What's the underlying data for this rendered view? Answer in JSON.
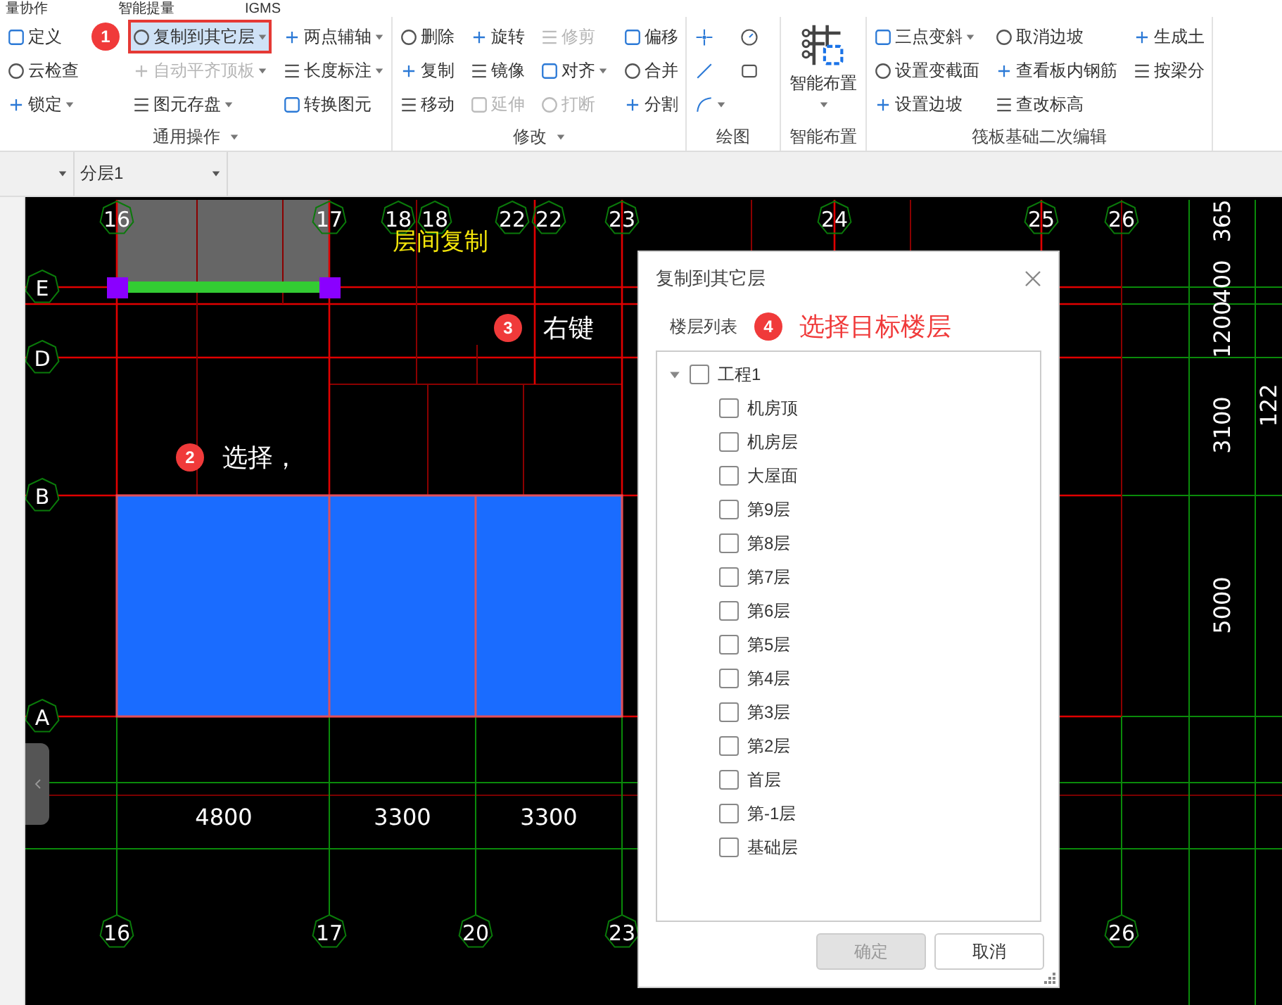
{
  "menu_tabs": [
    "量协作",
    "智能提量",
    "IGMS"
  ],
  "ribbon": {
    "groups": [
      {
        "kind": "columns",
        "title": "通用操作",
        "dropdown": true,
        "columns": [
          [
            {
              "label": "定义",
              "dropdown": false,
              "selected": false,
              "disabled": false
            },
            {
              "label": "云检查",
              "dropdown": false,
              "selected": false,
              "disabled": false
            },
            {
              "label": "锁定",
              "dropdown": true,
              "selected": false,
              "disabled": false
            }
          ],
          [
            {
              "label": "复制到其它层",
              "dropdown": true,
              "selected": true,
              "disabled": false
            },
            {
              "label": "自动平齐顶板",
              "dropdown": true,
              "selected": false,
              "disabled": true
            },
            {
              "label": "图元存盘",
              "dropdown": true,
              "selected": false,
              "disabled": false
            }
          ],
          [
            {
              "label": "两点辅轴",
              "dropdown": true,
              "selected": false,
              "disabled": false
            },
            {
              "label": "长度标注",
              "dropdown": true,
              "selected": false,
              "disabled": false
            },
            {
              "label": "转换图元",
              "dropdown": false,
              "selected": false,
              "disabled": false
            }
          ]
        ]
      },
      {
        "kind": "columns",
        "title": "修改",
        "dropdown": true,
        "columns": [
          [
            {
              "label": "删除",
              "dropdown": false,
              "selected": false,
              "disabled": false
            },
            {
              "label": "复制",
              "dropdown": false,
              "selected": false,
              "disabled": false
            },
            {
              "label": "移动",
              "dropdown": false,
              "selected": false,
              "disabled": false
            }
          ],
          [
            {
              "label": "旋转",
              "dropdown": false,
              "selected": false,
              "disabled": false
            },
            {
              "label": "镜像",
              "dropdown": false,
              "selected": false,
              "disabled": false
            },
            {
              "label": "延伸",
              "dropdown": false,
              "selected": false,
              "disabled": true
            }
          ],
          [
            {
              "label": "修剪",
              "dropdown": false,
              "selected": false,
              "disabled": true
            },
            {
              "label": "对齐",
              "dropdown": true,
              "selected": false,
              "disabled": false
            },
            {
              "label": "打断",
              "dropdown": false,
              "selected": false,
              "disabled": true
            }
          ],
          [
            {
              "label": "偏移",
              "dropdown": false,
              "selected": false,
              "disabled": false
            },
            {
              "label": "合并",
              "dropdown": false,
              "selected": false,
              "disabled": false
            },
            {
              "label": "分割",
              "dropdown": false,
              "selected": false,
              "disabled": false
            }
          ]
        ]
      },
      {
        "kind": "icons",
        "title": "绘图",
        "dropdown": false,
        "tools": [
          {
            "kind": "point",
            "dropdown": false
          },
          {
            "kind": "circle",
            "dropdown": false
          },
          {
            "kind": "line",
            "dropdown": false
          },
          {
            "kind": "rect",
            "dropdown": false
          },
          {
            "kind": "arc",
            "dropdown": true
          }
        ]
      },
      {
        "kind": "big",
        "title": "智能布置",
        "dropdown": false,
        "tool": {
          "label": "智能布置",
          "dropdown": true
        }
      },
      {
        "kind": "columns",
        "title": "筏板基础二次编辑",
        "dropdown": false,
        "columns": [
          [
            {
              "label": "三点变斜",
              "dropdown": true,
              "selected": false,
              "disabled": false
            },
            {
              "label": "设置变截面",
              "dropdown": false,
              "selected": false,
              "disabled": false
            },
            {
              "label": "设置边坡",
              "dropdown": false,
              "selected": false,
              "disabled": false
            }
          ],
          [
            {
              "label": "取消边坡",
              "dropdown": false,
              "selected": false,
              "disabled": false
            },
            {
              "label": "查看板内钢筋",
              "dropdown": false,
              "selected": false,
              "disabled": false
            },
            {
              "label": "查改标高",
              "dropdown": false,
              "selected": false,
              "disabled": false
            }
          ],
          [
            {
              "label": "生成土",
              "dropdown": false,
              "selected": false,
              "disabled": false
            },
            {
              "label": "按梁分",
              "dropdown": false,
              "selected": false,
              "disabled": false
            }
          ]
        ]
      }
    ]
  },
  "layer_bar": {
    "layer": "分层1"
  },
  "annotations": [
    {
      "number": "1"
    },
    {
      "number": "2",
      "text": "选择，"
    },
    {
      "number": "3",
      "text": "右键"
    },
    {
      "number": "4",
      "text": "选择目标楼层"
    }
  ],
  "canvas": {
    "note": "层间复制",
    "top_axis_labels": [
      "16",
      "17",
      "18",
      "18",
      "22",
      "22",
      "23",
      "24",
      "25",
      "26"
    ],
    "bottom_axis_labels": [
      "16",
      "17",
      "20",
      "23",
      "26"
    ],
    "row_axis_labels": [
      "E",
      "D",
      "B",
      "A"
    ],
    "dimensions_horizontal": [
      "4800",
      "3300",
      "3300"
    ],
    "dimensions_vertical": [
      "365",
      "400",
      "1200",
      "3100",
      "5000",
      "122"
    ]
  },
  "dialog": {
    "title": "复制到其它层",
    "tab": "楼层列表",
    "tree": {
      "label": "工程1",
      "expanded": true,
      "checked": false,
      "children": [
        {
          "label": "机房顶",
          "checked": false
        },
        {
          "label": "机房层",
          "checked": false
        },
        {
          "label": "大屋面",
          "checked": false
        },
        {
          "label": "第9层",
          "checked": false
        },
        {
          "label": "第8层",
          "checked": false
        },
        {
          "label": "第7层",
          "checked": false
        },
        {
          "label": "第6层",
          "checked": false
        },
        {
          "label": "第5层",
          "checked": false
        },
        {
          "label": "第4层",
          "checked": false
        },
        {
          "label": "第3层",
          "checked": false
        },
        {
          "label": "第2层",
          "checked": false
        },
        {
          "label": "首层",
          "checked": false
        },
        {
          "label": "第-1层",
          "checked": false
        },
        {
          "label": "基础层",
          "checked": false
        }
      ]
    },
    "buttons": [
      {
        "label": "确定",
        "disabled": true
      },
      {
        "label": "取消",
        "disabled": false
      }
    ]
  }
}
